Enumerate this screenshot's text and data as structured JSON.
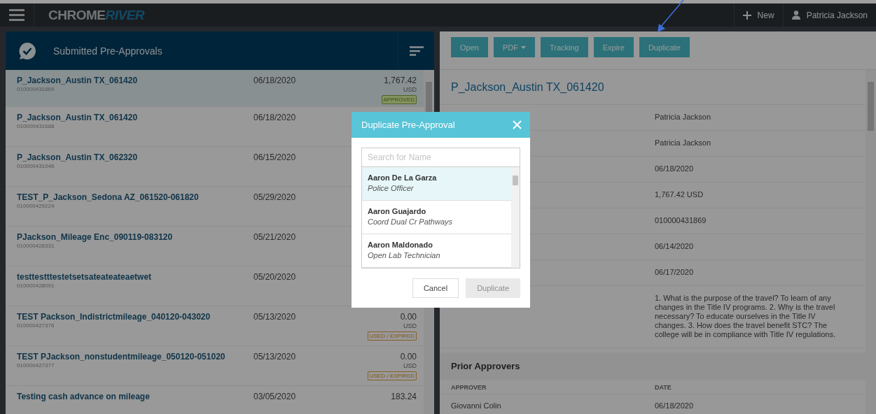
{
  "header": {
    "logo": {
      "part_1": "CHROME",
      "part_2": "RIVER"
    },
    "new_button": "New",
    "user": "Patricia Jackson"
  },
  "list_panel": {
    "title": "Submitted Pre-Approvals",
    "items": [
      {
        "name": "P_Jackson_Austin TX_061420",
        "id": "010000431869",
        "date": "06/18/2020",
        "amount": "1,767.42",
        "currency": "USD",
        "status": {
          "kind": "approved",
          "label": "APPROVED"
        },
        "selected": true
      },
      {
        "name": "P_Jackson_Austin TX_061420",
        "id": "010000431688",
        "date": "06/18/2020",
        "selected": false
      },
      {
        "name": "P_Jackson_Austin TX_062320",
        "id": "010000431046",
        "date": "06/15/2020",
        "selected": false
      },
      {
        "name": "TEST_P_Jackson_Sedona AZ_061520-061820",
        "id": "010000429224",
        "date": "05/29/2020",
        "selected": false
      },
      {
        "name": "PJackson_Mileage Enc_090119-083120",
        "id": "010000428331",
        "date": "05/21/2020",
        "selected": false
      },
      {
        "name": "testtestttestetsetsateateateaetwet",
        "id": "010000428091",
        "date": "05/20/2020",
        "selected": false
      },
      {
        "name": "TEST Packson_Indistrictmileage_040120-043020",
        "id": "010000427376",
        "date": "05/13/2020",
        "amount": "0.00",
        "currency": "USD",
        "status": {
          "kind": "used_expired",
          "label": "USED / EXPIRED"
        },
        "selected": false
      },
      {
        "name": "TEST PJackson_nonstudentmileage_050120-051020",
        "id": "010000427377",
        "date": "05/13/2020",
        "amount": "0.00",
        "currency": "USD",
        "status": {
          "kind": "used_expired",
          "label": "USED / EXPIRED"
        },
        "selected": false
      },
      {
        "name": "Testing cash advance on mileage",
        "date": "03/05/2020",
        "amount": "183.24",
        "selected": false
      }
    ]
  },
  "detail_panel": {
    "actions": [
      {
        "label": "Open",
        "dropdown": false
      },
      {
        "label": "PDF",
        "dropdown": true
      },
      {
        "label": "Tracking",
        "dropdown": false
      },
      {
        "label": "Expire",
        "dropdown": false
      },
      {
        "label": "Duplicate",
        "dropdown": false
      }
    ],
    "title": "P_Jackson_Austin TX_061420",
    "field_values": [
      "Patricia Jackson",
      "Patricia Jackson",
      "06/18/2020",
      "1,767.42 USD",
      "010000431869",
      "06/14/2020",
      "06/17/2020",
      "1. What is the purpose of the travel? To learn of any changes in the Title IV programs. 2. Why is the travel necessary? To educate ourselves in the Title IV changes. 3. How does the travel benefit STC? The college will be in compliance with Title IV regulations."
    ],
    "prior_approvers": {
      "title": "Prior Approvers",
      "columns": [
        "APPROVER",
        "DATE"
      ],
      "rows": [
        [
          "Giovanni Colin",
          "06/18/2020"
        ]
      ]
    }
  },
  "dialog": {
    "title": "Duplicate Pre-Approval",
    "search": {
      "placeholder": "Search for Name"
    },
    "people": [
      {
        "name": "Aaron De La Garza",
        "role": "Police Officer",
        "selected": true
      },
      {
        "name": "Aaron Guajardo",
        "role": "Coord Dual Cr Pathways",
        "selected": false
      },
      {
        "name": "Aaron Maldonado",
        "role": "Open Lab Technician",
        "selected": false
      }
    ],
    "buttons": [
      {
        "label": "Cancel",
        "disabled": false
      },
      {
        "label": "Duplicate",
        "disabled": true
      }
    ]
  }
}
